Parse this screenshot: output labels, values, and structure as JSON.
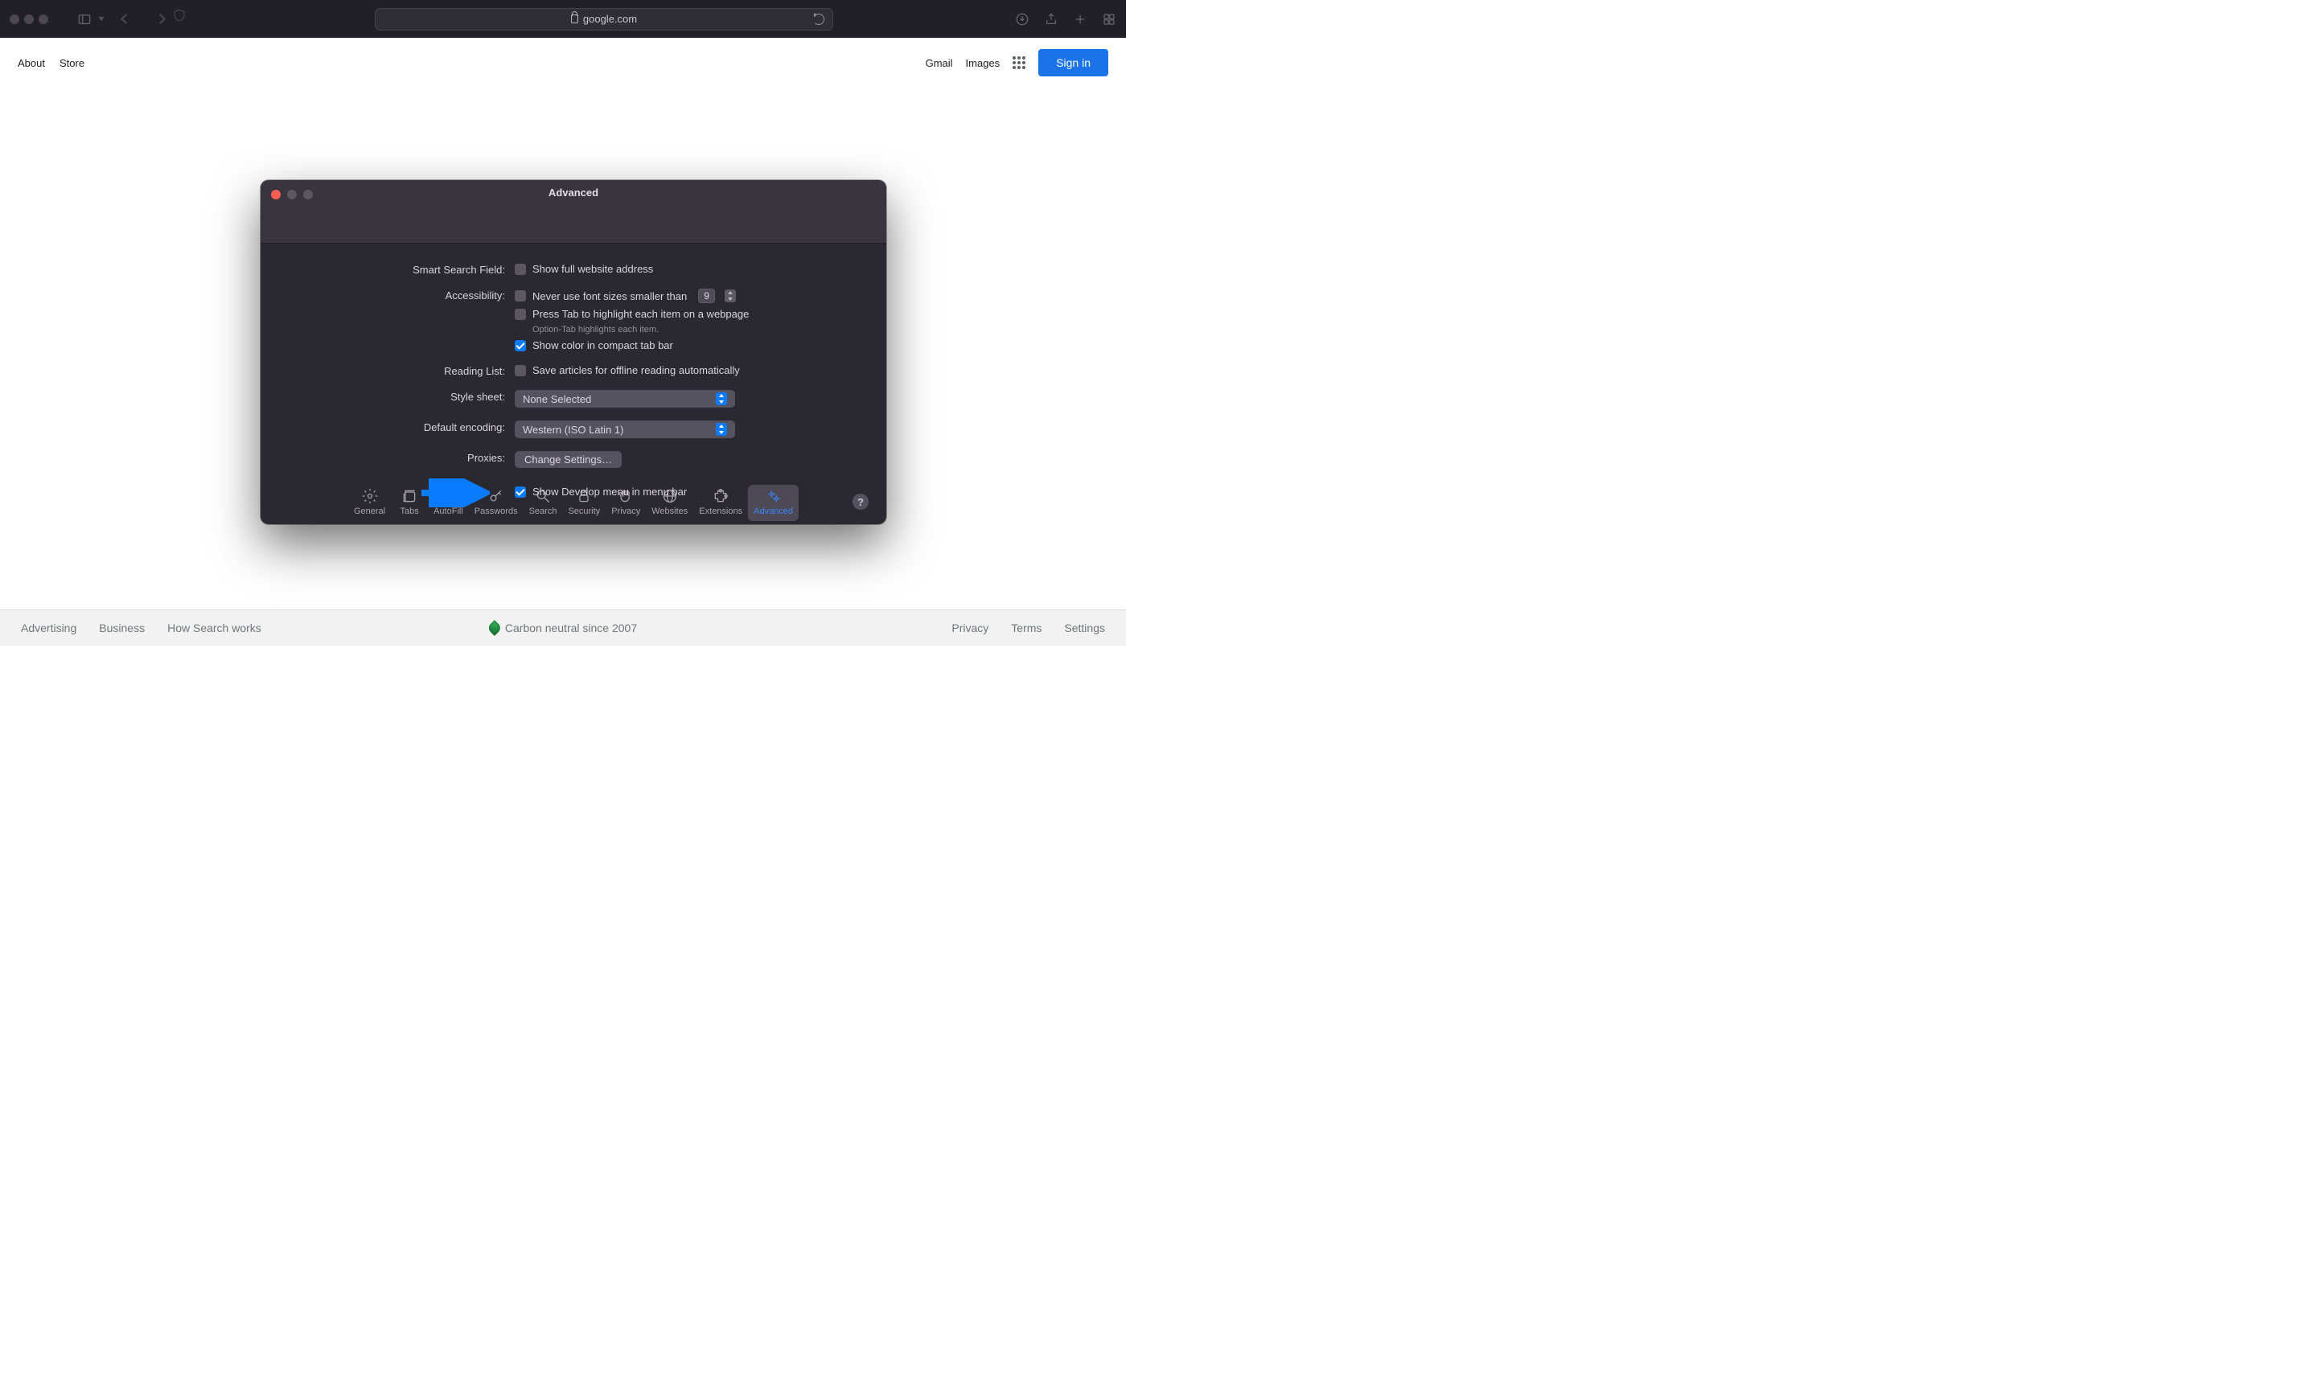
{
  "safari": {
    "url_host": "google.com"
  },
  "google": {
    "header": {
      "about": "About",
      "store": "Store",
      "gmail": "Gmail",
      "images": "Images",
      "signin": "Sign in"
    },
    "footer": {
      "advertising": "Advertising",
      "business": "Business",
      "how_search_works": "How Search works",
      "carbon": "Carbon neutral since 2007",
      "privacy": "Privacy",
      "terms": "Terms",
      "settings": "Settings"
    }
  },
  "prefs": {
    "title": "Advanced",
    "tabs": {
      "general": "General",
      "tabs": "Tabs",
      "autofill": "AutoFill",
      "passwords": "Passwords",
      "search": "Search",
      "security": "Security",
      "privacy": "Privacy",
      "websites": "Websites",
      "extensions": "Extensions",
      "advanced": "Advanced"
    },
    "labels": {
      "smart_search": "Smart Search Field:",
      "accessibility": "Accessibility:",
      "reading_list": "Reading List:",
      "style_sheet": "Style sheet:",
      "default_encoding": "Default encoding:",
      "proxies": "Proxies:"
    },
    "options": {
      "show_full_address": "Show full website address",
      "never_use_font_sizes": "Never use font sizes smaller than",
      "font_size_value": "9",
      "press_tab": "Press Tab to highlight each item on a webpage",
      "option_tab_hint": "Option-Tab highlights each item.",
      "show_color_compact": "Show color in compact tab bar",
      "save_articles_offline": "Save articles for offline reading automatically",
      "style_sheet_value": "None Selected",
      "encoding_value": "Western (ISO Latin 1)",
      "change_settings": "Change Settings…",
      "show_develop_menu": "Show Develop menu in menu bar"
    },
    "help": "?"
  }
}
